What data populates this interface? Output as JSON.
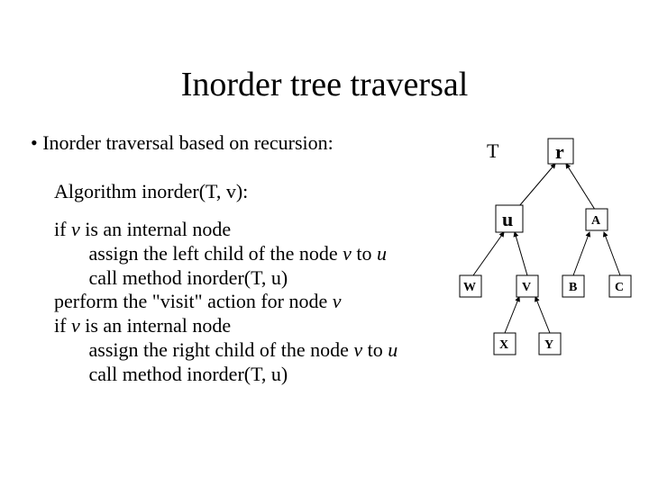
{
  "title": "Inorder tree traversal",
  "bullet": "Inorder traversal based on recursion:",
  "algline": "Algorithm inorder(T, v):",
  "pseudo": {
    "l1a": "if ",
    "l1b": "v",
    "l1c": " is an internal node",
    "l2a": "       assign the left child of the node ",
    "l2b": "v",
    "l2c": " to ",
    "l2d": "u",
    "l3": "       call method inorder(T, u)",
    "l4a": "perform the \"visit\" action for node ",
    "l4b": "v",
    "l5a": "if ",
    "l5b": "v",
    "l5c": " is an internal node",
    "l6a": "       assign the right child of the node ",
    "l6b": "v",
    "l6c": " to ",
    "l6d": "u",
    "l7": "       call method inorder(T, u)"
  },
  "diagram": {
    "T": "T",
    "r": "r",
    "u": "u",
    "A": "A",
    "W": "W",
    "V": "V",
    "B": "B",
    "C": "C",
    "X": "X",
    "Y": "Y"
  }
}
